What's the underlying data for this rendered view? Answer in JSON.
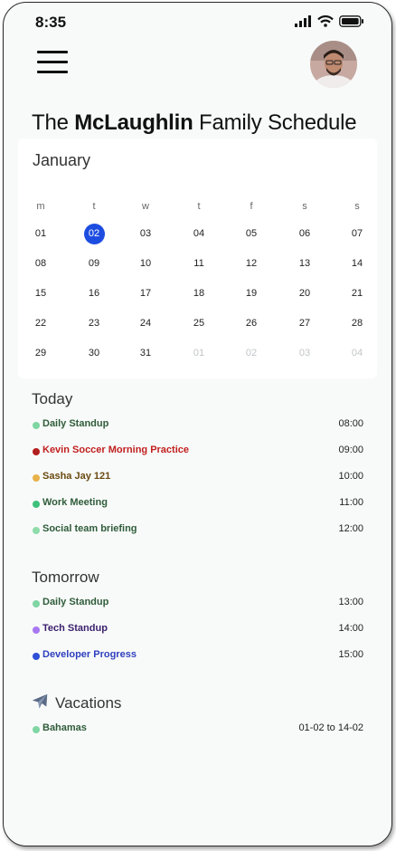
{
  "status_bar": {
    "time": "8:35"
  },
  "header": {
    "title_prefix": "The",
    "title_bold": "McLaughlin",
    "title_suffix": "Family Schedule"
  },
  "calendar": {
    "month": "January",
    "weekdays": [
      "m",
      "t",
      "w",
      "t",
      "f",
      "s",
      "s"
    ],
    "weeks": [
      [
        "01",
        "02",
        "03",
        "04",
        "05",
        "06",
        "07"
      ],
      [
        "08",
        "09",
        "10",
        "11",
        "12",
        "13",
        "14"
      ],
      [
        "15",
        "16",
        "17",
        "18",
        "19",
        "20",
        "21"
      ],
      [
        "22",
        "23",
        "24",
        "25",
        "26",
        "27",
        "28"
      ],
      [
        "29",
        "30",
        "31",
        "01",
        "02",
        "03",
        "04"
      ]
    ],
    "selected_day": "02"
  },
  "today": {
    "title": "Today",
    "events": [
      {
        "label": "Daily Standup",
        "time": "08:00",
        "color": "#7fd6a3",
        "text_color": "#2f5c3a"
      },
      {
        "label": "Kevin Soccer Morning Practice",
        "time": "09:00",
        "color": "#b21f1f",
        "text_color": "#c0201f"
      },
      {
        "label": "Sasha Jay 121",
        "time": "10:00",
        "color": "#e8b24a",
        "text_color": "#6a4a12"
      },
      {
        "label": "Work Meeting",
        "time": "11:00",
        "color": "#3fc07a",
        "text_color": "#2f5c3a"
      },
      {
        "label": "Social team briefing",
        "time": "12:00",
        "color": "#8fdcab",
        "text_color": "#2f5c3a"
      }
    ]
  },
  "tomorrow": {
    "title": "Tomorrow",
    "events": [
      {
        "label": "Daily Standup",
        "time": "13:00",
        "color": "#7fd6a3",
        "text_color": "#2f5c3a"
      },
      {
        "label": "Tech Standup",
        "time": "14:00",
        "color": "#a779f0",
        "text_color": "#3a1f6e"
      },
      {
        "label": "Developer Progress",
        "time": "15:00",
        "color": "#2f4fd6",
        "text_color": "#2f3fbf"
      }
    ]
  },
  "vacations": {
    "title": "Vacations",
    "icon": "airplane-icon",
    "events": [
      {
        "label": "Bahamas",
        "time": "01-02 to 14-02",
        "color": "#7fd6a3",
        "text_color": "#2f5c3a"
      }
    ]
  }
}
